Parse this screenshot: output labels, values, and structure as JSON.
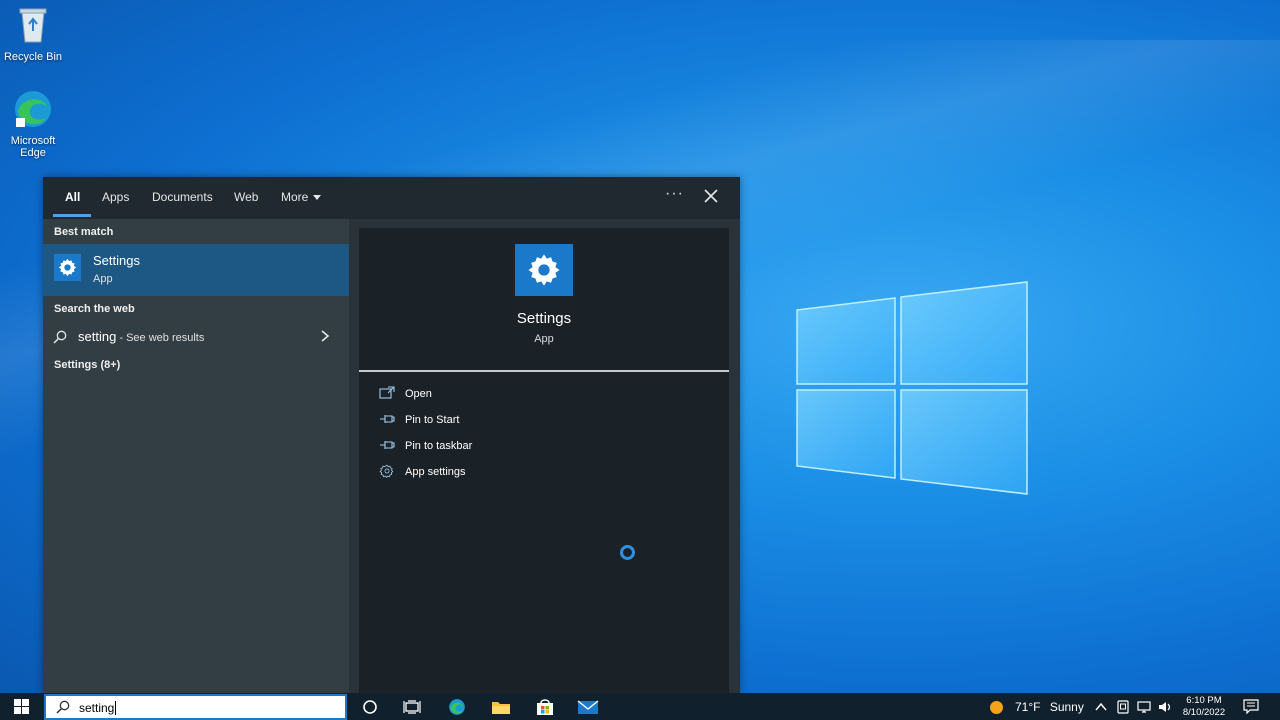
{
  "desktop": {
    "icons": [
      {
        "label": "Recycle Bin"
      },
      {
        "label": "Microsoft Edge"
      }
    ]
  },
  "search_panel": {
    "tabs": [
      {
        "label": "All",
        "active": true
      },
      {
        "label": "Apps"
      },
      {
        "label": "Documents"
      },
      {
        "label": "Web"
      },
      {
        "label": "More"
      }
    ],
    "more_options_label": "···",
    "left": {
      "best_match_label": "Best match",
      "best_match": {
        "title": "Settings",
        "subtitle": "App"
      },
      "search_web_label": "Search the web",
      "web_result": {
        "query": "setting",
        "suffix": " - See web results"
      },
      "settings_count_label": "Settings (8+)"
    },
    "preview": {
      "title": "Settings",
      "subtitle": "App",
      "actions": [
        {
          "label": "Open",
          "icon": "open-icon"
        },
        {
          "label": "Pin to Start",
          "icon": "pin-icon"
        },
        {
          "label": "Pin to taskbar",
          "icon": "pin-icon"
        },
        {
          "label": "App settings",
          "icon": "gear-icon"
        }
      ]
    }
  },
  "taskbar": {
    "search_text": "setting",
    "weather": {
      "temp": "71°F",
      "condition": "Sunny"
    },
    "clock": {
      "time": "6:10 PM",
      "date": "8/10/2022"
    }
  },
  "colors": {
    "accent": "#1a79c8",
    "best_match_bg": "#1d5784",
    "panel_bg": "#2a3339",
    "preview_bg": "#1b2227",
    "taskbar_bg": "#10202c"
  }
}
